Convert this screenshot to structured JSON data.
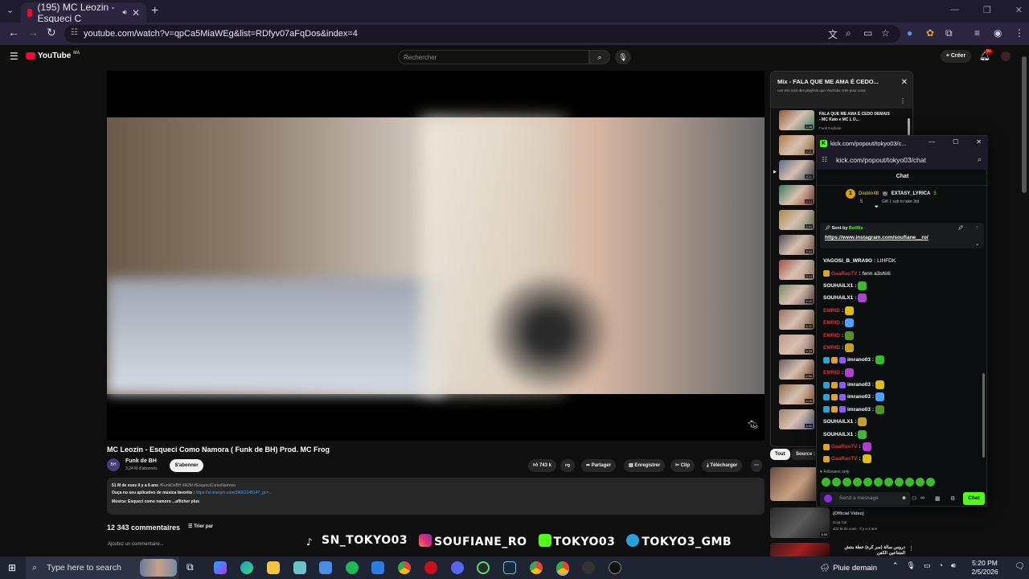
{
  "browser": {
    "tab_title": "(195) MC Leozin - Esqueci C",
    "url": "youtube.com/watch?v=qpCa5MiaWEg&list=RDfyv07aFqDos&index=4"
  },
  "youtube": {
    "logo_text": "YouTube",
    "country": "MA",
    "search_placeholder": "Rechercher",
    "create_label": "Créer",
    "notif_count": "9+",
    "video_title": "MC Leozin - Esqueci Como Namora ( Funk de BH) Prod. MC Frog",
    "channel_name": "Funk de BH",
    "subscribers": "3,24 M d'abonnés",
    "subscribe_label": "S'abonner",
    "likes": "743 k",
    "share_label": "Partager",
    "save_label": "Enregistrer",
    "clip_label": "Clip",
    "download_label": "Télécharger",
    "desc_meta": "51 M de vues  il y a 6 ans ",
    "desc_tags": "#FunkDeBH #A2M #EsqueciComoNamora",
    "desc_line2": "Ouça no seu aplicativo de música favorito : ",
    "desc_link": "https://sl.onerpm.com/3966224914?_gc=...",
    "desc_line3": "Música: Esqueci como namoro",
    "desc_more": "...afficher plus",
    "comments_count": "12 343 commentaires",
    "sort_label": "Trier par",
    "add_comment": "Ajoutez un commentaire..."
  },
  "overlay": {
    "handle1": "SN_TOKYO03",
    "handle2": "SOUFIANE_RO",
    "handle3": "TOKYO03",
    "handle4": "TOKYO3_GMB"
  },
  "playlist": {
    "title": "Mix - FALA QUE ME AMA É CEDO...",
    "subtitle": "Les mix sont des playlists que YouTube crée pour vous",
    "first_title": "FALA QUE ME AMA É CEDO DEMAIS - MC Kaio e MC L D...",
    "first_channel": "Funk Explode",
    "durations": [
      "2:46",
      "2:21",
      "3:21",
      "2:14",
      "2:44",
      "3:40",
      "2:14",
      "2:26",
      "2:32",
      "2:33",
      "2:56",
      "2:09",
      "2:40"
    ]
  },
  "chips": {
    "all": "Tout",
    "source": "Source :"
  },
  "recs": [
    {
      "title": "(Official Video)",
      "channel": "Doja Cat",
      "meta": "402 M de vues · il y a 4 ans",
      "duration": "3:40"
    },
    {
      "title": "دروس سالة (سر كرة) خطة بنتش المتناعين الكفن",
      "duration": ""
    }
  ],
  "kick": {
    "window_title": "kick.com/popout/tokyo03/c...",
    "url": "kick.com/popout/tokyo03/chat",
    "chat_header": "Chat",
    "sub_user1": "Diablo48",
    "sub_user2": "EXTASY_LYRICA",
    "sub_count": "5",
    "sub_badge": "5",
    "gift_text": "Gift 1 sub to take 3rd",
    "pin_sent": "Sent by",
    "pin_bot": "BotRix",
    "pin_url": "https://www.instagram.com/soufiane__ro/",
    "messages": [
      {
        "user": "VAGOSI_B_WRA9O",
        "color": "#ffffff",
        "text": "LIHFDK"
      },
      {
        "user": "GaaRasTV",
        "color": "#e0303a",
        "text": "fenn a3shirii"
      },
      {
        "user": "SOUHAILX1",
        "color": "#ffffff",
        "text": ""
      },
      {
        "user": "SOUHAILX1",
        "color": "#ffffff",
        "text": ""
      },
      {
        "user": "EMRID",
        "color": "#e0303a",
        "text": ""
      },
      {
        "user": "EMRID",
        "color": "#e0303a",
        "text": ""
      },
      {
        "user": "EMRID",
        "color": "#e0303a",
        "text": ""
      },
      {
        "user": "EMRID",
        "color": "#e0303a",
        "text": ""
      },
      {
        "user": "imrano03",
        "color": "#ffffff",
        "text": ""
      },
      {
        "user": "EMRID",
        "color": "#e0303a",
        "text": ""
      },
      {
        "user": "imrano03",
        "color": "#ffffff",
        "text": ""
      },
      {
        "user": "imrano03",
        "color": "#ffffff",
        "text": ""
      },
      {
        "user": "imrano03",
        "color": "#ffffff",
        "text": ""
      },
      {
        "user": "SOUHAILX1",
        "color": "#ffffff",
        "text": ""
      },
      {
        "user": "SOUHAILX1",
        "color": "#ffffff",
        "text": ""
      },
      {
        "user": "GaaRasTV",
        "color": "#e0303a",
        "text": ""
      },
      {
        "user": "GaaRasTV",
        "color": "#e0303a",
        "text": ""
      }
    ],
    "followers_only": "Followers only",
    "input_placeholder": "Send a message",
    "send_label": "Chat"
  },
  "taskbar": {
    "search_placeholder": "Type here to search",
    "weather": "Pluie demain",
    "time": "5:20 PM",
    "date": "2/5/2026"
  }
}
